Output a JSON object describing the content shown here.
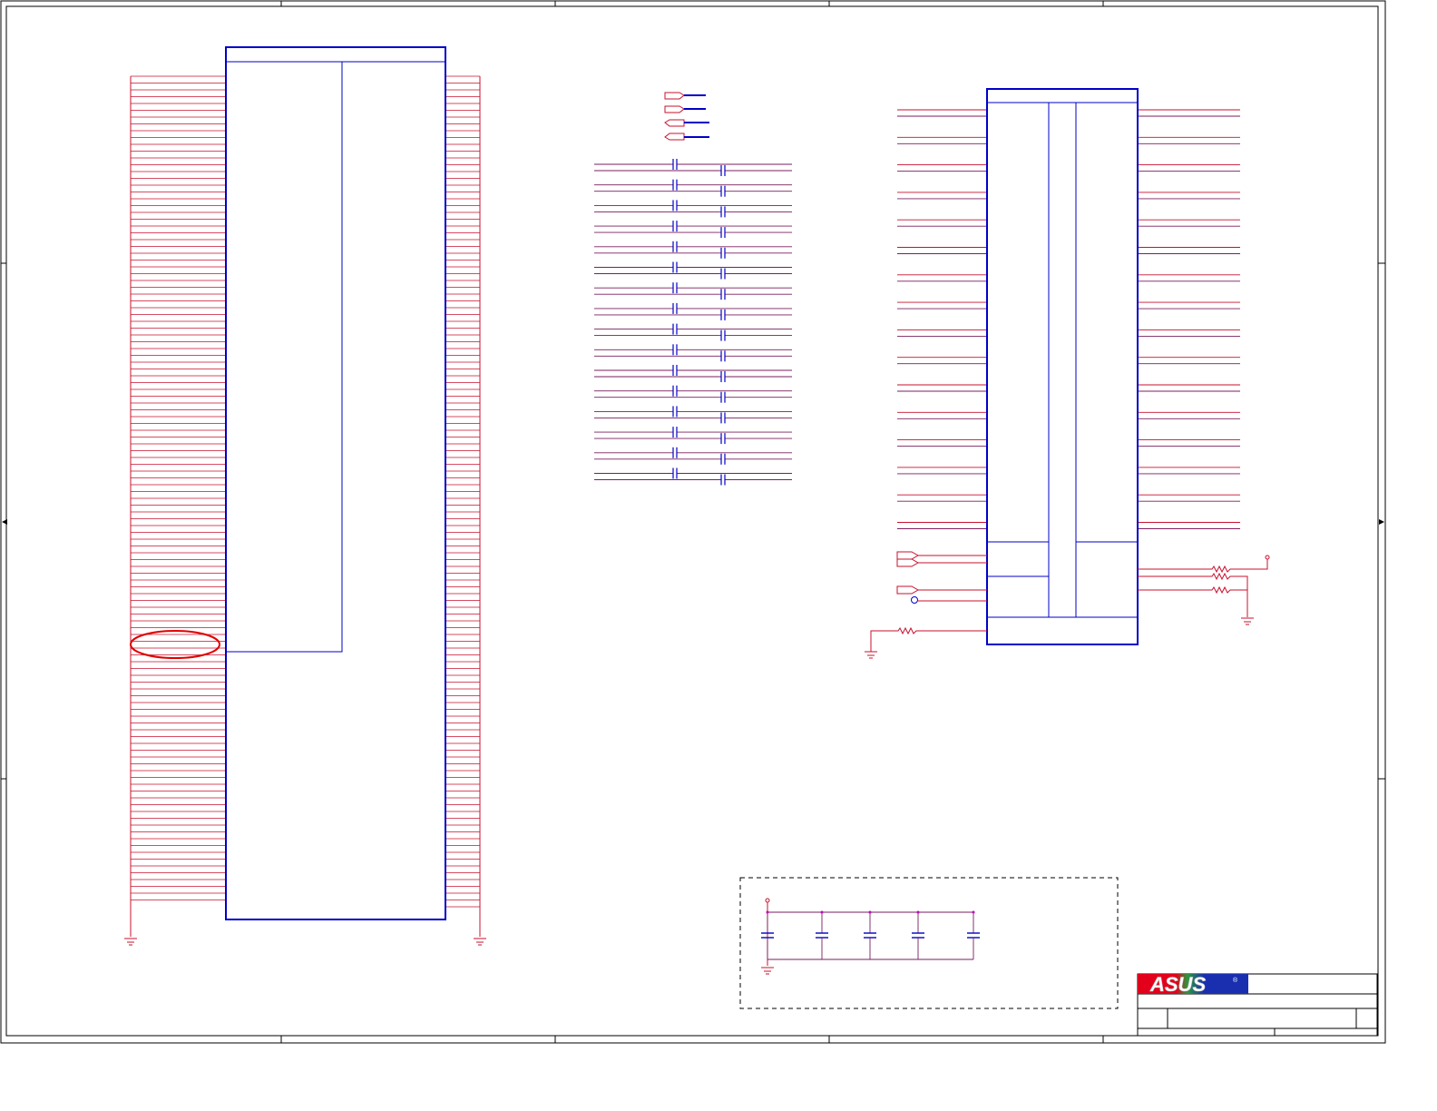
{
  "title_block": {
    "logo_text": "ASUS",
    "logo_mark": "®"
  },
  "colors": {
    "frame": "#000000",
    "component": "#0000c8",
    "net_wire": "#c8102e",
    "net_wire_alt": "#7a1f5c",
    "highlight": "#e00000",
    "logo_red": "#e3001b",
    "logo_blue": "#1a2fb0"
  },
  "icons": {
    "ground": "ground-symbol-icon",
    "capacitor": "capacitor-icon",
    "resistor": "resistor-icon",
    "port": "offpage-connector-icon",
    "power": "power-pin-icon"
  }
}
